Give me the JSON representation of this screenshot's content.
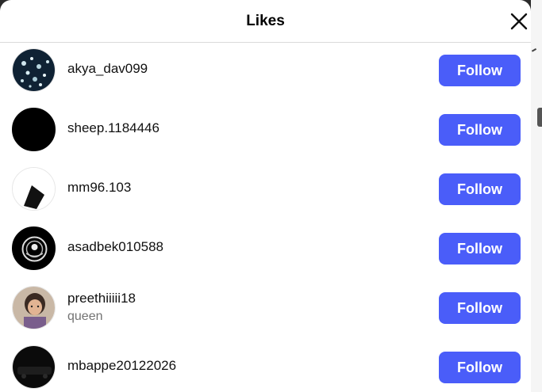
{
  "dialog": {
    "title": "Likes"
  },
  "follow_label": "Follow",
  "users": [
    {
      "username": "akya_dav099",
      "subtitle": ""
    },
    {
      "username": "sheep.1184446",
      "subtitle": ""
    },
    {
      "username": "mm96.103",
      "subtitle": ""
    },
    {
      "username": "asadbek010588",
      "subtitle": ""
    },
    {
      "username": "preethiiiii18",
      "subtitle": "queen"
    },
    {
      "username": "mbappe20122026",
      "subtitle": ""
    }
  ],
  "colors": {
    "follow_button": "#4a5df9",
    "subtitle_text": "#737373"
  },
  "icons": {
    "close": "close-icon"
  }
}
